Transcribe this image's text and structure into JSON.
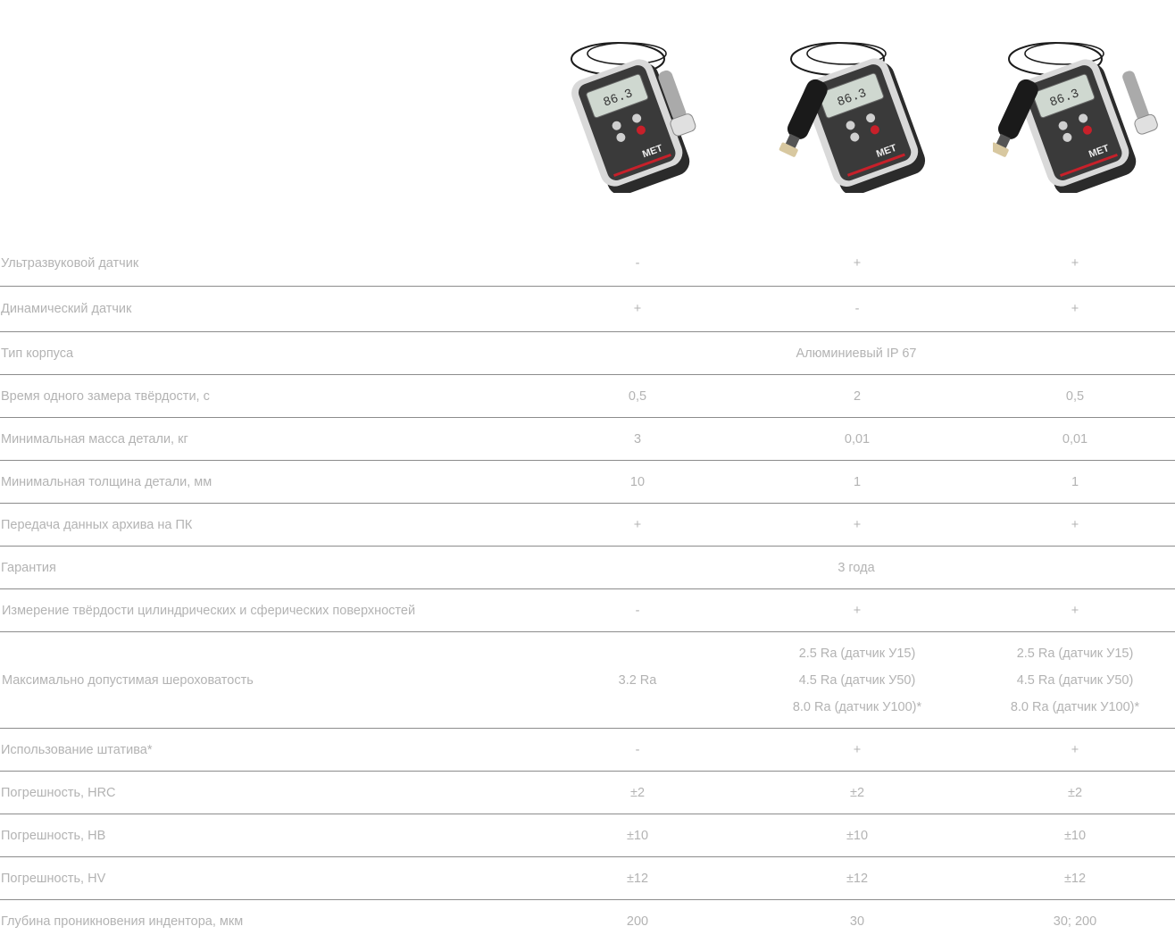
{
  "products": [
    {
      "name": "device-1",
      "screen_value": "86.3",
      "probe": "dynamic"
    },
    {
      "name": "device-2",
      "screen_value": "86.3",
      "probe": "ultrasonic"
    },
    {
      "name": "device-3",
      "screen_value": "86.3",
      "probe": "both"
    }
  ],
  "colors": {
    "text": "#b3b3b3",
    "divider": "#8c8c8c",
    "brand_red": "#c8202a",
    "lcd": "#cfd8d0"
  },
  "rows": [
    {
      "label": "Ультразвуковой датчик",
      "values": [
        "-",
        "+",
        "+"
      ]
    },
    {
      "label": "Динамический датчик",
      "values": [
        "+",
        "-",
        "+"
      ]
    },
    {
      "label": "Тип корпуса",
      "span": "Алюминиевый IP 67"
    },
    {
      "label": "Время одного замера твёрдости, с",
      "values": [
        "0,5",
        "2",
        "0,5"
      ]
    },
    {
      "label": "Минимальная масса детали, кг",
      "values": [
        "3",
        "0,01",
        "0,01"
      ]
    },
    {
      "label": "Минимальная толщина детали, мм",
      "values": [
        "10",
        "1",
        "1"
      ]
    },
    {
      "label": "Передача данных архива на ПК",
      "values": [
        "+",
        "+",
        "+"
      ]
    },
    {
      "label": "Гарантия",
      "span": "3 года"
    },
    {
      "label": "Измерение твёрдости цилиндрических и сферических поверхностей",
      "values": [
        "-",
        "+",
        "+"
      ]
    },
    {
      "label": "Максимально допустимая шероховатость",
      "values_multi": [
        [
          "3.2 Ra"
        ],
        [
          "2.5 Ra (датчик У15)",
          "4.5 Ra (датчик У50)",
          "8.0 Ra (датчик У100)*"
        ],
        [
          "2.5 Ra (датчик У15)",
          "4.5 Ra (датчик У50)",
          "8.0 Ra (датчик У100)*"
        ]
      ]
    },
    {
      "label": "Использование штатива*",
      "values": [
        "-",
        "+",
        "+"
      ]
    },
    {
      "label": "Погрешность, HRC",
      "values": [
        "±2",
        "±2",
        "±2"
      ]
    },
    {
      "label": "Погрешность, HB",
      "values": [
        "±10",
        "±10",
        "±10"
      ]
    },
    {
      "label": "Погрешность, HV",
      "values": [
        "±12",
        "±12",
        "±12"
      ]
    },
    {
      "label": "Глубина проникновения индентора, мкм",
      "values": [
        "200",
        "30",
        "30; 200"
      ]
    }
  ]
}
